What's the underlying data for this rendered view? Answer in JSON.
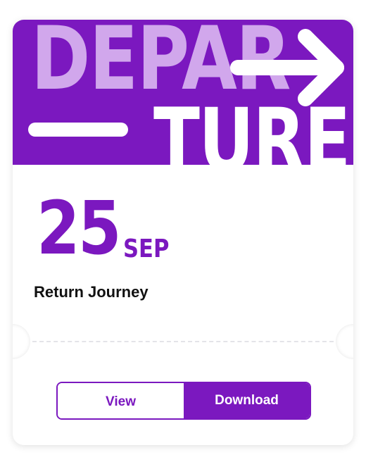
{
  "banner": {
    "word_top": "DEPAR",
    "word_bottom": "TURE",
    "arrow_icon": "arrow-right-icon",
    "colors": {
      "background": "#7b18bf",
      "word_top": "#d1a7ec",
      "word_bottom": "#ffffff"
    }
  },
  "date": {
    "day": "25",
    "month": "SEP"
  },
  "journey_label": "Return Journey",
  "actions": {
    "view_label": "View",
    "download_label": "Download"
  },
  "colors": {
    "accent": "#7b18bf",
    "card": "#ffffff",
    "divider": "#e4e4e8"
  }
}
